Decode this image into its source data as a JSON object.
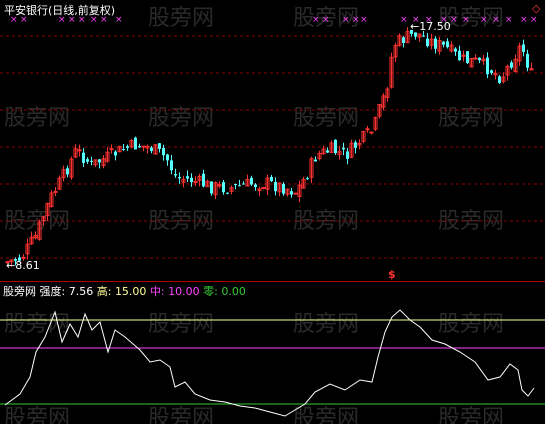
{
  "watermark": "股旁网",
  "main_panel": {
    "title": "平安银行(日线,前复权)",
    "high_label": "17.50",
    "low_label": "8.61",
    "low_arrow": "←",
    "high_arrow": "←",
    "signal_marker": "$",
    "corner_marker": "◇"
  },
  "indicator_panel": {
    "name": "股旁网",
    "label_strength": "强度:",
    "value_strength": "7.56",
    "label_high": "高:",
    "value_high": "15.00",
    "label_mid": "中:",
    "value_mid": "10.00",
    "label_zero": "零:",
    "value_zero": "0.00",
    "high_level": 15,
    "mid_level": 10,
    "zero_level": 0
  },
  "colors": {
    "up": "#ff3232",
    "down": "#54ffff",
    "grid": "#8b0000",
    "strength_line": "#ffffff",
    "high_line": "#ffff99",
    "mid_line": "#ff44ff",
    "zero_line": "#33cc33",
    "signal": "#ff3333",
    "marker": "#ff44ff"
  }
}
